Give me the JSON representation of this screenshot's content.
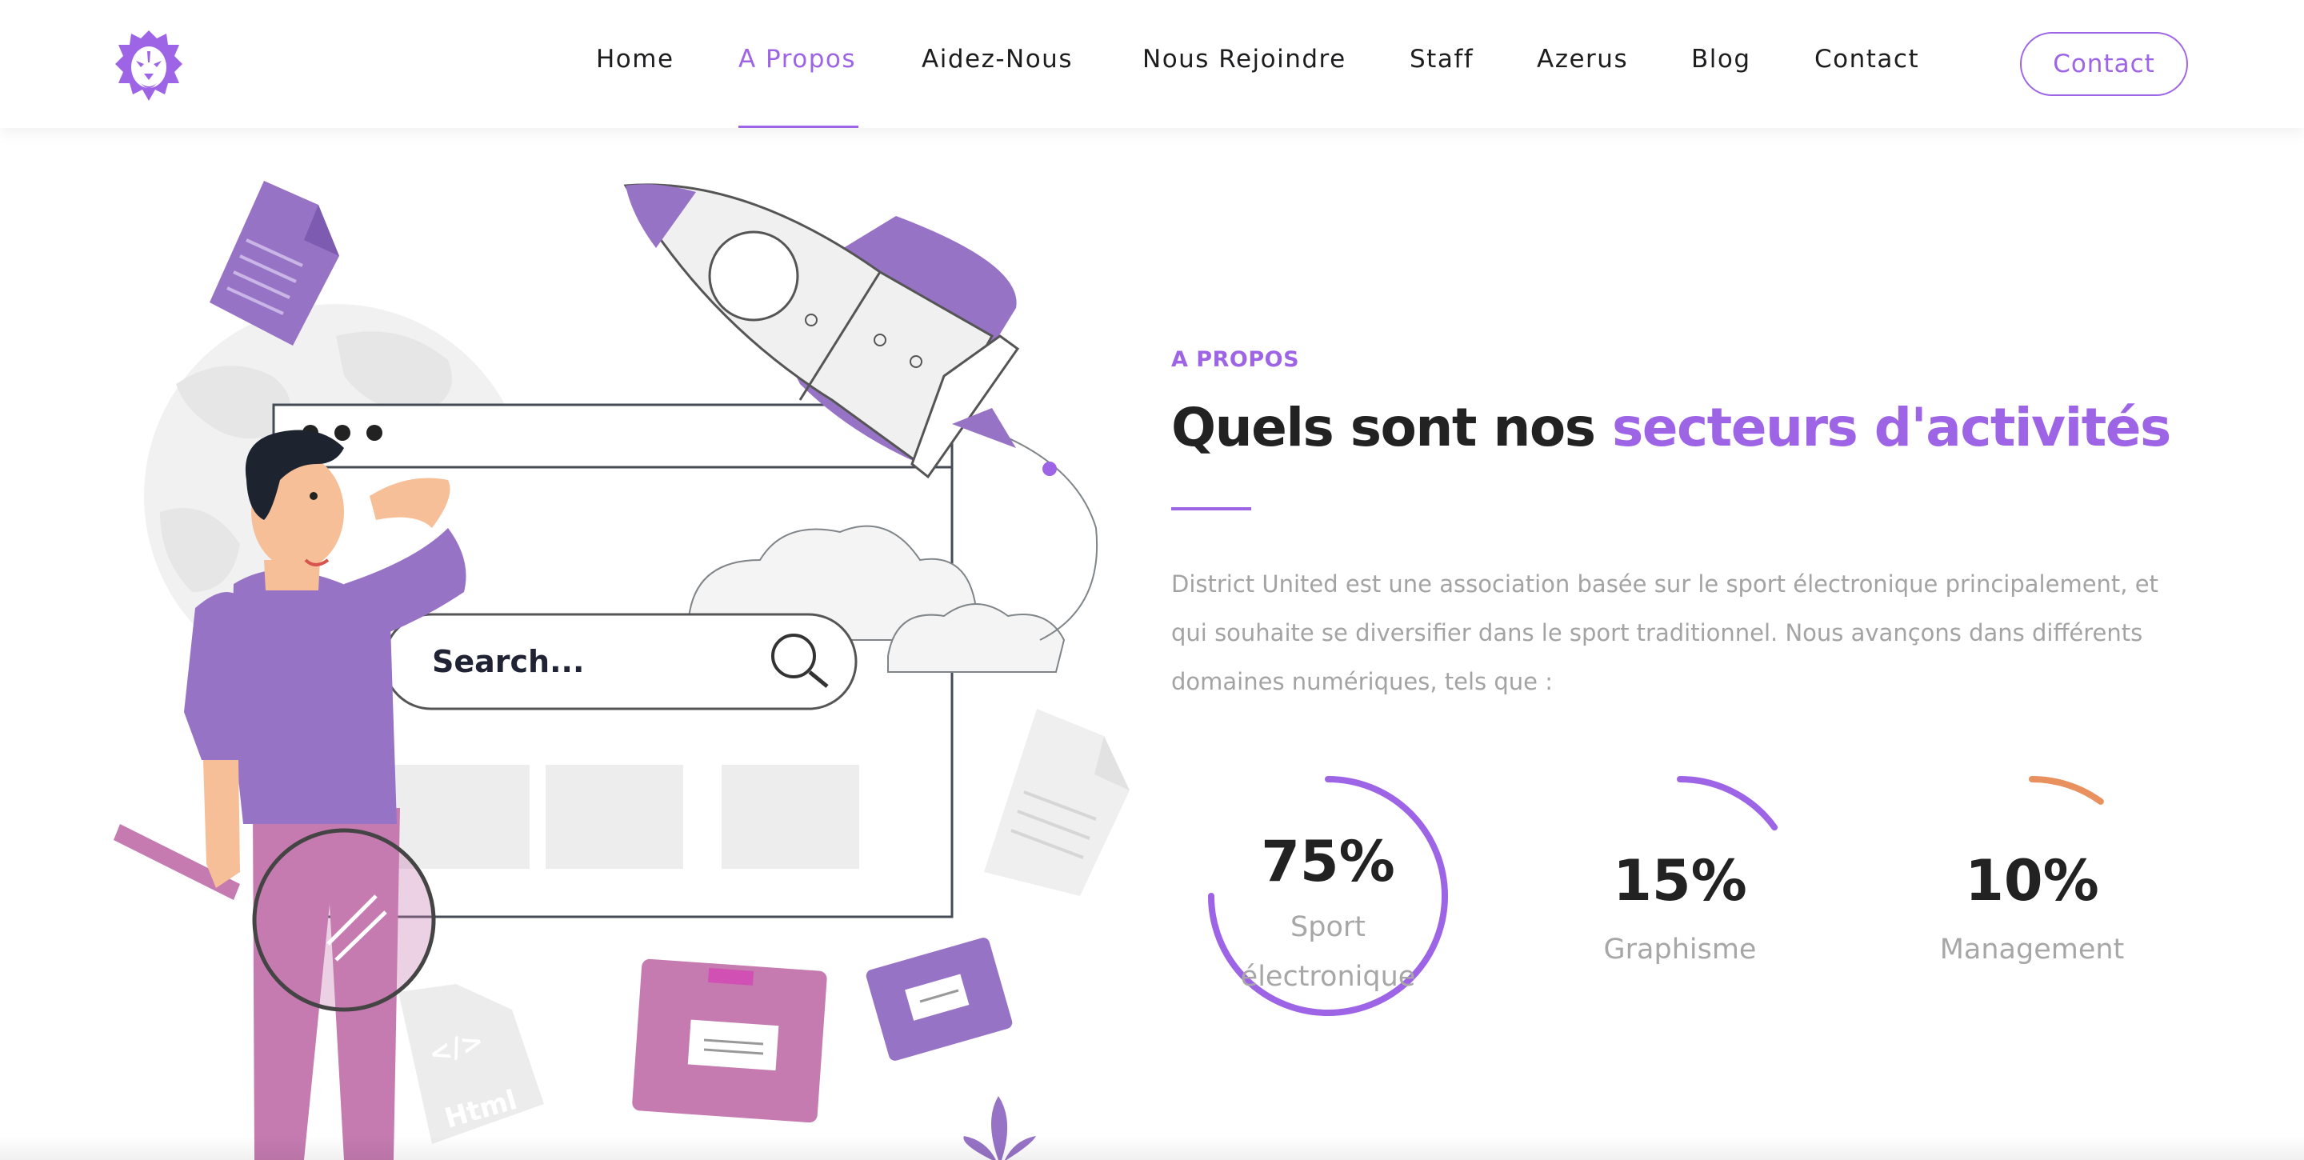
{
  "header": {
    "logo_icon": "lion-head-icon",
    "nav": [
      {
        "label": "Home",
        "active": false
      },
      {
        "label": "A Propos",
        "active": true
      },
      {
        "label": "Aidez-Nous",
        "active": false
      },
      {
        "label": "Nous Rejoindre",
        "active": false
      },
      {
        "label": "Staff",
        "active": false
      },
      {
        "label": "Azerus",
        "active": false
      },
      {
        "label": "Blog",
        "active": false
      },
      {
        "label": "Contact",
        "active": false
      }
    ],
    "cta_label": "Contact"
  },
  "illustration": {
    "search_text": "Search...",
    "html_tag": "</>",
    "html_label": "Html"
  },
  "about": {
    "eyebrow": "A PROPOS",
    "title_main": "Quels sont nos ",
    "title_accent": "secteurs d'activités",
    "description": "District United est une association basée sur le sport électronique principalement, et qui souhaite se diversifier dans le sport traditionnel. Nous avançons dans différents domaines numériques, tels que :"
  },
  "stats": [
    {
      "value_label": "75%",
      "percent": 75,
      "label": "Sport électronique",
      "color": "#9d64e6"
    },
    {
      "value_label": "15%",
      "percent": 15,
      "label": "Graphisme",
      "color": "#9d64e6"
    },
    {
      "value_label": "10%",
      "percent": 10,
      "label": "Management",
      "color": "#e8905e"
    }
  ],
  "colors": {
    "accent": "#9d64e6",
    "secondary": "#e8905e",
    "heading": "#222222",
    "muted": "#a3a3a3"
  }
}
